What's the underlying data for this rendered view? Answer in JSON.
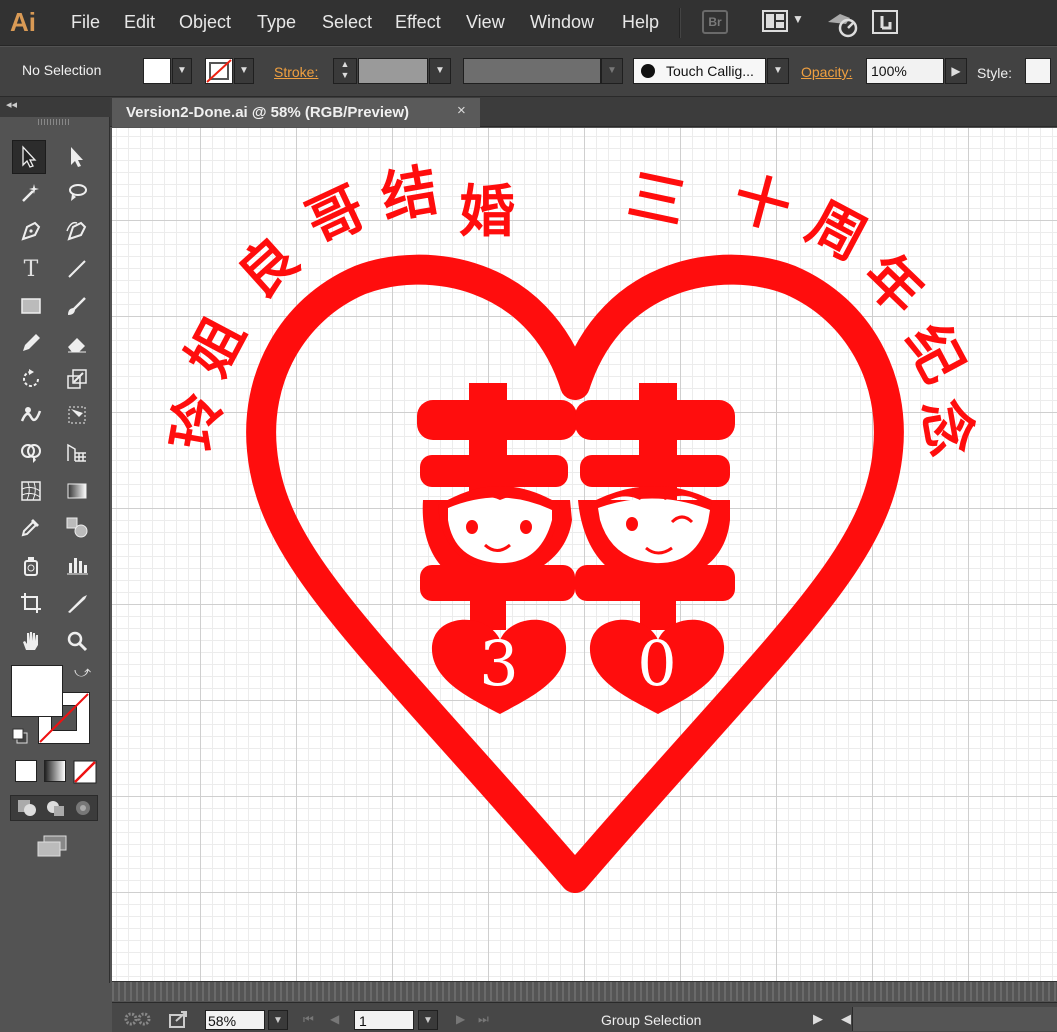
{
  "app": {
    "logo": "Ai"
  },
  "menu": [
    "File",
    "Edit",
    "Object",
    "Type",
    "Select",
    "Effect",
    "View",
    "Window",
    "Help"
  ],
  "bridge_label": "Br",
  "control": {
    "selection": "No Selection",
    "stroke_label": "Stroke:",
    "brush": "Touch Callig...",
    "opacity_label": "Opacity:",
    "opacity_value": "100%",
    "style_label": "Style:"
  },
  "document": {
    "tab_title": "Version2-Done.ai @ 58% (RGB/Preview)",
    "close": "×"
  },
  "artwork": {
    "color": "#ff0d0d",
    "arc_text": [
      "玲",
      "姐",
      "良",
      "哥",
      "结",
      "婚",
      "三",
      "十",
      "周",
      "年",
      "纪",
      "念"
    ],
    "digits": [
      "3",
      "0"
    ]
  },
  "status": {
    "zoom": "58%",
    "artboard": "1",
    "text": "Group Selection"
  },
  "colors": {
    "ui_dark": "#323232",
    "ui_mid": "#535353",
    "accent_label": "#f0a040"
  },
  "icons": [
    "selection-tool",
    "direct-selection-tool",
    "magic-wand",
    "lasso",
    "pen",
    "curvature",
    "type",
    "line",
    "rectangle",
    "paintbrush",
    "pencil",
    "eraser",
    "rotate",
    "scale",
    "warp",
    "free-transform",
    "shape-builder",
    "perspective-grid",
    "mesh",
    "gradient",
    "eyedropper",
    "blend",
    "symbol-sprayer",
    "column-graph",
    "artboard",
    "slice",
    "hand",
    "zoom"
  ]
}
